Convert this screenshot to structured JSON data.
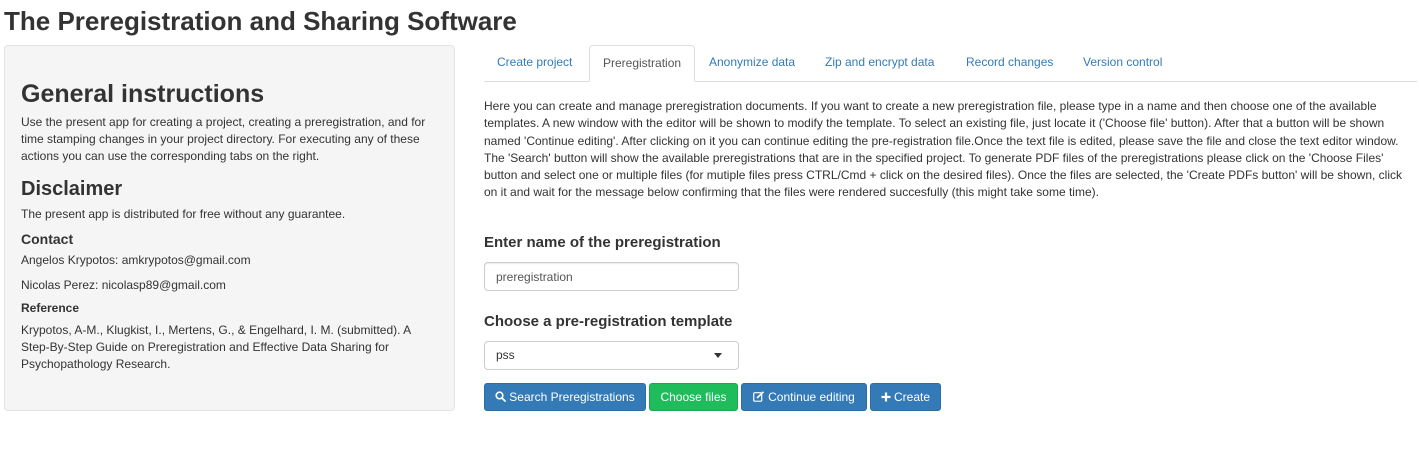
{
  "app": {
    "title": "The Preregistration and Sharing Software"
  },
  "sidebar": {
    "general_heading": "General instructions",
    "general_text": "Use the present app for creating a project, creating a preregistration, and for time stamping changes in your project directory. For executing any of these actions you can use the corresponding tabs on the right.",
    "disclaimer_heading": "Disclaimer",
    "disclaimer_text": "The present app is distributed for free without any guarantee.",
    "contact_heading": "Contact",
    "contacts": [
      "Angelos Krypotos: amkrypotos@gmail.com",
      "Nicolas Perez: nicolasp89@gmail.com"
    ],
    "reference_heading": "Reference",
    "reference_text": "Krypotos, A-M., Klugkist, I., Mertens, G., & Engelhard, I. M. (submitted). A Step-By-Step Guide on Preregistration and Effective Data Sharing for Psychopathology Research."
  },
  "tabs": [
    {
      "label": "Create project",
      "active": false
    },
    {
      "label": "Preregistration",
      "active": true
    },
    {
      "label": "Anonymize data",
      "active": false
    },
    {
      "label": "Zip and encrypt data",
      "active": false
    },
    {
      "label": "Record changes",
      "active": false
    },
    {
      "label": "Version control",
      "active": false
    }
  ],
  "main": {
    "intro": "Here you can create and manage preregistration documents. If you want to create a new preregistration file, please type in a name and then choose one of the available templates. A new window with the editor will be shown to modify the template. To select an existing file, just locate it ('Choose file' button). After that a button will be shown named 'Continue editing'. After clicking on it you can continue editing the pre-registration file.Once the text file is edited, please save the file and close the text editor window. The 'Search' button will show the available preregistrations that are in the specified project. To generate PDF files of the preregistrations please click on the 'Choose Files' button and select one or multiple files (for mutiple files press CTRL/Cmd + click on the desired files). Once the files are selected, the 'Create PDFs button' will be shown, click on it and wait for the message below confirming that the files were rendered succesfully (this might take some time).",
    "name_label": "Enter name of the preregistration",
    "name_value": "preregistration",
    "template_label": "Choose a pre-registration template",
    "template_selected": "pss",
    "buttons": {
      "search": "Search Preregistrations",
      "choose": "Choose files",
      "continue": "Continue editing",
      "create": "Create"
    }
  },
  "colors": {
    "primary": "#337ab7",
    "success": "#1fbc5c",
    "link": "#337ab7",
    "sidebar_bg": "#f5f5f5"
  },
  "icons": {
    "search": "search-icon",
    "continue": "edit-icon",
    "create": "plus-icon",
    "select": "caret-down-icon"
  }
}
